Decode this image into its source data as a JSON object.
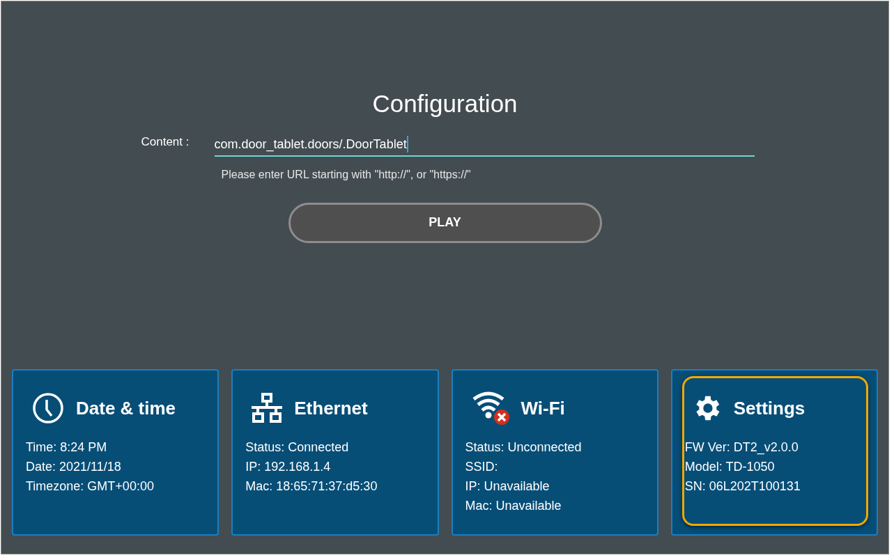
{
  "title": "Configuration",
  "content_field": {
    "label": "Content :",
    "value": "com.door_tablet.doors/.DoorTablet",
    "hint": "Please enter URL starting with \"http://\", or \"https://\""
  },
  "play_button": "PLAY",
  "cards": [
    {
      "kind": "clock",
      "title": "Date & time",
      "highlighted": false,
      "lines": [
        "Time: 8:24 PM",
        "Date: 2021/11/18",
        "Timezone: GMT+00:00"
      ]
    },
    {
      "kind": "network",
      "title": "Ethernet",
      "highlighted": false,
      "lines": [
        "Status: Connected",
        "IP: 192.168.1.4",
        "Mac: 18:65:71:37:d5:30"
      ]
    },
    {
      "kind": "wifi-off",
      "title": "Wi-Fi",
      "highlighted": false,
      "lines": [
        "Status: Unconnected",
        "SSID:",
        "IP: Unavailable",
        "Mac: Unavailable"
      ]
    },
    {
      "kind": "gear",
      "title": "Settings",
      "highlighted": true,
      "lines": [
        "FW Ver: DT2_v2.0.0",
        "Model: TD-1050",
        "SN: 06L202T100131"
      ]
    }
  ]
}
